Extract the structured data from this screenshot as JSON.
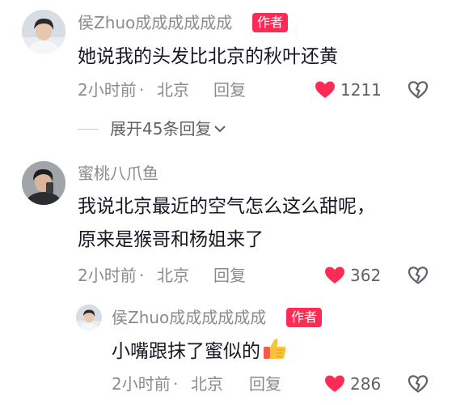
{
  "comments": [
    {
      "username": "侯Zhuo成成成成成成",
      "author_badge": "作者",
      "lines": [
        "她说我的头发比北京的秋叶还黄"
      ],
      "time": "2小时前",
      "location": "北京",
      "reply_label": "回复",
      "likes": "1211",
      "expand_label": "展开45条回复"
    },
    {
      "username": "蜜桃八爪鱼",
      "lines": [
        "我说北京最近的空气怎么这么甜呢，",
        "原来是猴哥和杨姐来了"
      ],
      "time": "2小时前",
      "location": "北京",
      "reply_label": "回复",
      "likes": "362"
    },
    {
      "username": "侯Zhuo成成成成成成",
      "author_badge": "作者",
      "lines": [
        "小嘴跟抹了蜜似的"
      ],
      "time": "2小时前",
      "location": "北京",
      "reply_label": "回复",
      "likes": "286"
    }
  ],
  "meta_separator": " · ",
  "icons": {
    "like": "heart-filled-icon",
    "dislike": "broken-heart-icon",
    "expand": "chevron-down-icon",
    "emoji": "thumbs-up-emoji"
  },
  "colors": {
    "like_red": "#fe2c55",
    "badge_bg": "#fe2c55",
    "meta_gray": "#8a8b91",
    "text": "#161823"
  }
}
